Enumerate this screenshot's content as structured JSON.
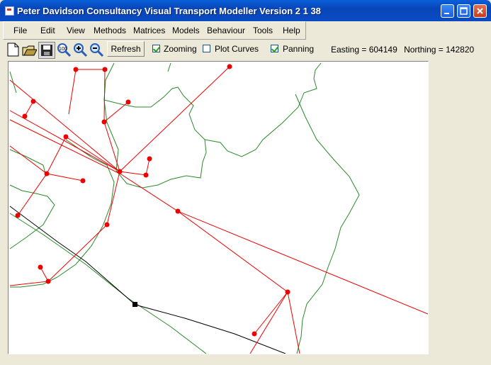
{
  "window": {
    "title": "Peter Davidson  Consultancy Visual Transport Modeller Version 2 1 38"
  },
  "menu": [
    {
      "label": "File"
    },
    {
      "label": "Edit"
    },
    {
      "label": "View"
    },
    {
      "label": "Methods"
    },
    {
      "label": "Matrices"
    },
    {
      "label": "Models"
    },
    {
      "label": "Behaviour"
    },
    {
      "label": "Tools"
    },
    {
      "label": "Help"
    }
  ],
  "toolbar": {
    "icons": [
      "new-file-icon",
      "open-folder-icon",
      "save-icon",
      "zoom-fit-icon",
      "zoom-in-icon",
      "zoom-out-icon"
    ],
    "refresh_label": "Refresh",
    "zooming": {
      "label": "Zooming",
      "checked": true
    },
    "plot_curves": {
      "label": "Plot Curves",
      "checked": false
    },
    "panning": {
      "label": "Panning",
      "checked": true
    }
  },
  "status": {
    "easting": "Easting = 604149",
    "northing": "Northing = 142820"
  },
  "map": {
    "colors": {
      "links": "#ff0000",
      "boundaries": "#2a8a2a",
      "route": "#000000",
      "background": "#ffffff"
    }
  }
}
